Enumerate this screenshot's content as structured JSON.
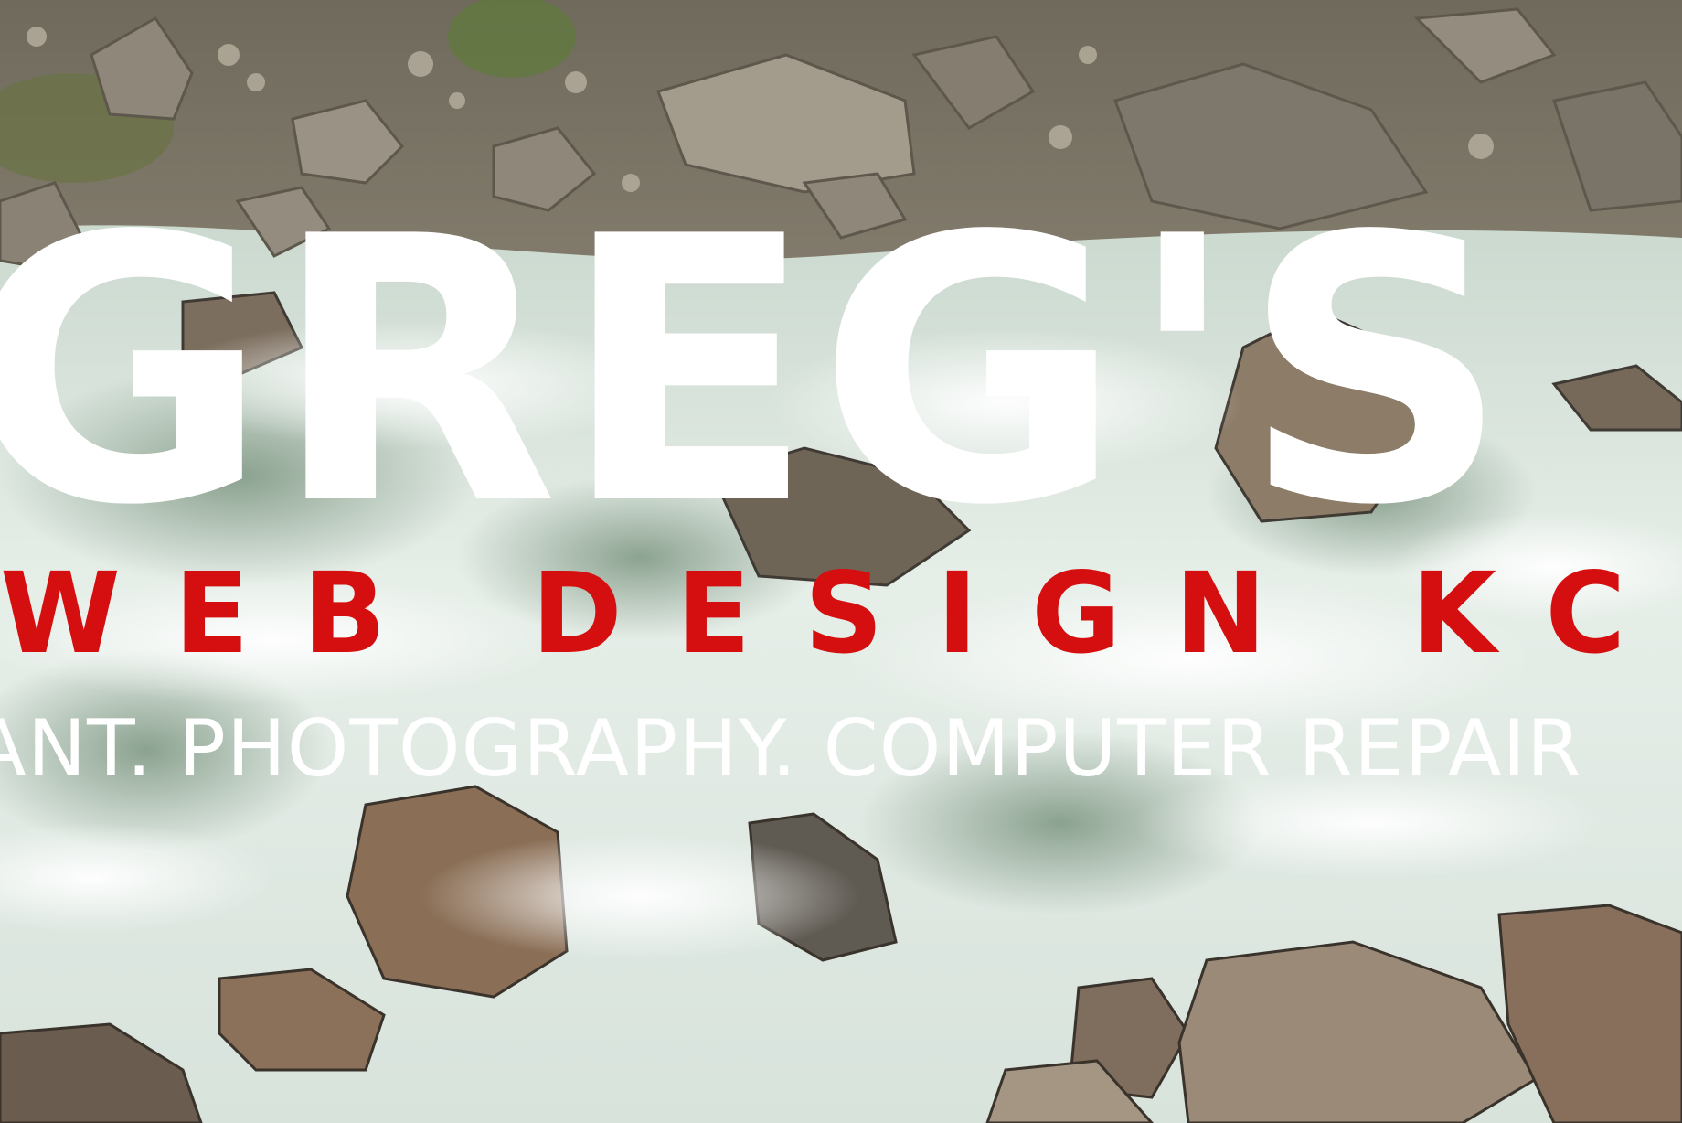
{
  "hero": {
    "title": "GREG'S",
    "subtitle": "WEB DESIGN KC",
    "tagline": "ANT. PHOTOGRAPHY. COMPUTER REPAIR"
  },
  "colors": {
    "title": "#ffffff",
    "subtitle": "#d50f0f",
    "tagline": "#ffffff",
    "water": "#dfe9e2",
    "rock": "#8a8072"
  }
}
